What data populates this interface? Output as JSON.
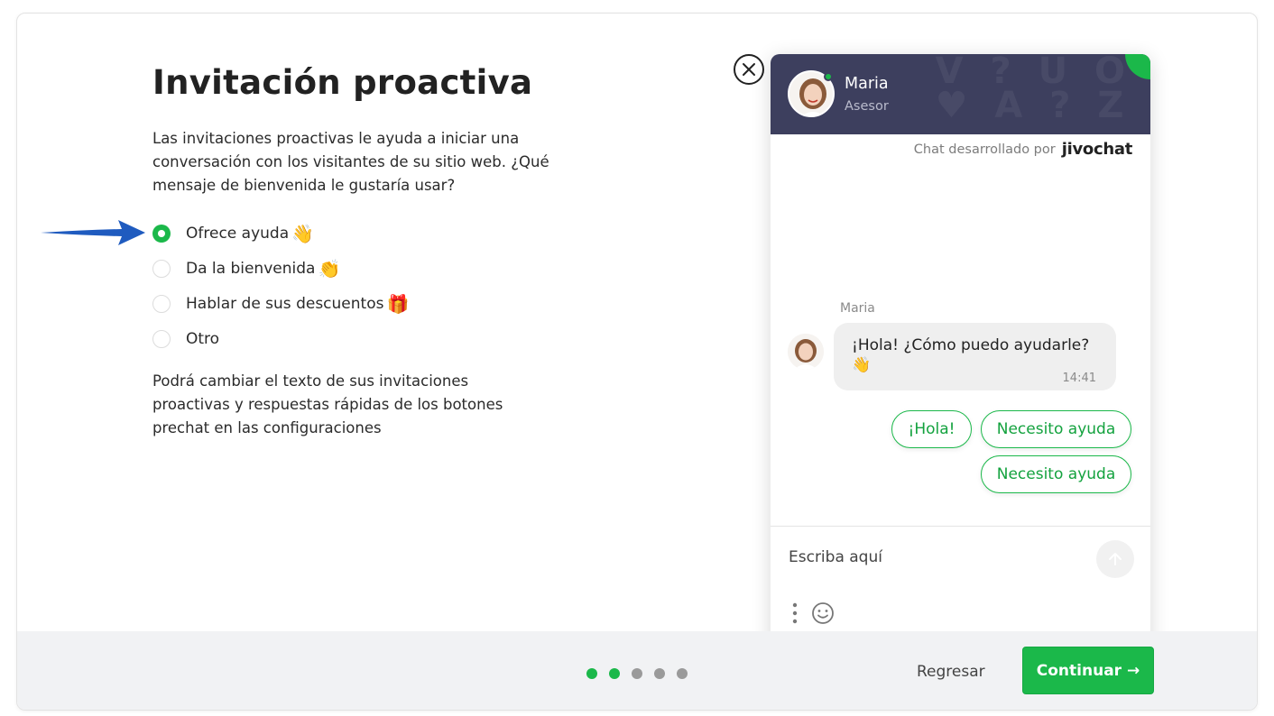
{
  "page": {
    "title": "Invitación proactiva",
    "description": "Las invitaciones proactivas le ayuda a iniciar una conversación con los visitantes de su sitio web. ¿Qué mensaje de bienvenida le gustaría usar?",
    "note": "Podrá cambiar el texto de sus invitaciones proactivas y respuestas rápidas de los botones prechat en las configuraciones"
  },
  "options": [
    {
      "label": "Ofrece ayuda",
      "emoji": "👋",
      "checked": true
    },
    {
      "label": "Da la bienvenida",
      "emoji": "👏",
      "checked": false
    },
    {
      "label": "Hablar de sus descuentos",
      "emoji": "🎁",
      "checked": false
    },
    {
      "label": "Otro",
      "emoji": "",
      "checked": false
    }
  ],
  "chat": {
    "agent_name": "Maria",
    "agent_role": "Asesor",
    "powered_by": "Chat desarrollado por",
    "brand": "jivochat",
    "sender": "Maria",
    "message": "¡Hola! ¿Cómo puedo ayudarle?",
    "message_emoji": "👋",
    "time": "14:41",
    "quick_replies": [
      "¡Hola!",
      "Necesito ayuda",
      "Necesito ayuda"
    ],
    "input_placeholder": "Escriba aquí"
  },
  "footer": {
    "steps_total": 5,
    "steps_completed": 2,
    "back_label": "Regresar",
    "continue_label": "Continuar →"
  },
  "colors": {
    "accent": "#1bb84a",
    "header_bg": "#3d3f5e",
    "arrow": "#1f5bbf"
  },
  "icons": {
    "arrow": "arrow-right-icon",
    "close": "close-icon",
    "send": "arrow-up-icon",
    "menu": "more-vertical-icon",
    "emoji": "smile-icon"
  }
}
